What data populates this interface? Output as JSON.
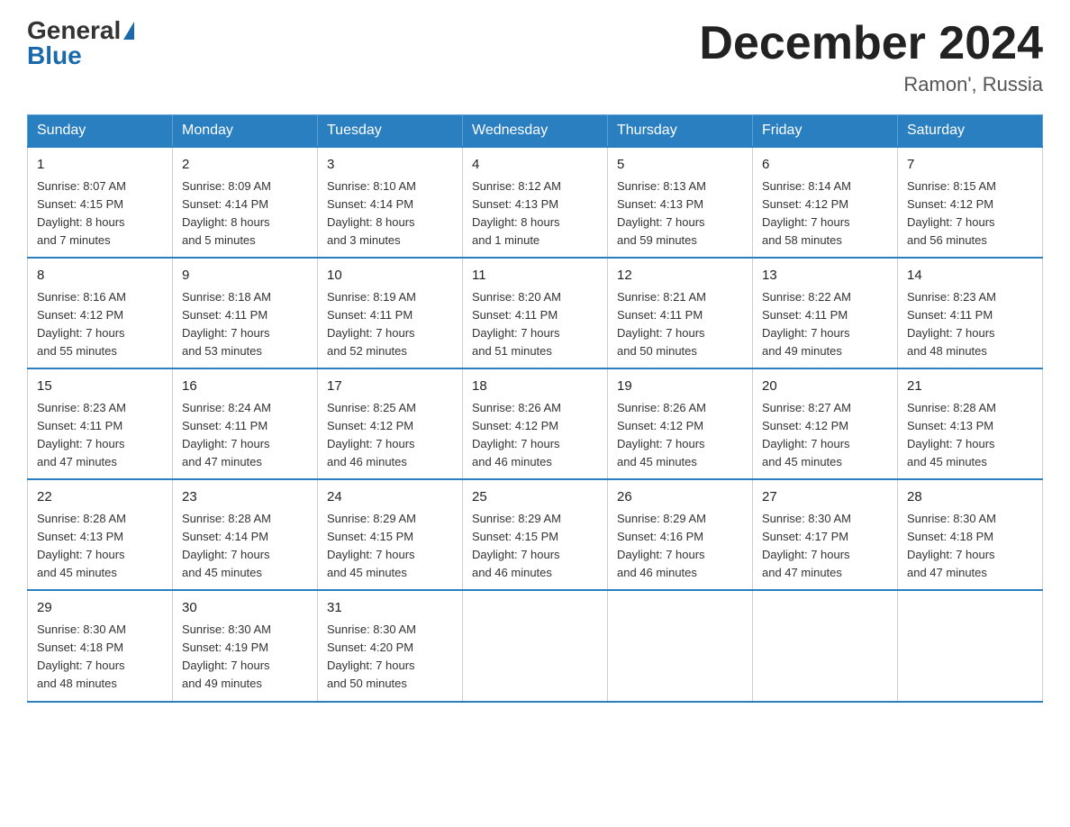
{
  "logo": {
    "general": "General",
    "blue": "Blue"
  },
  "title": {
    "month": "December 2024",
    "location": "Ramon', Russia"
  },
  "weekdays": [
    "Sunday",
    "Monday",
    "Tuesday",
    "Wednesday",
    "Thursday",
    "Friday",
    "Saturday"
  ],
  "weeks": [
    [
      {
        "day": "1",
        "sunrise": "8:07 AM",
        "sunset": "4:15 PM",
        "daylight": "8 hours and 7 minutes"
      },
      {
        "day": "2",
        "sunrise": "8:09 AM",
        "sunset": "4:14 PM",
        "daylight": "8 hours and 5 minutes"
      },
      {
        "day": "3",
        "sunrise": "8:10 AM",
        "sunset": "4:14 PM",
        "daylight": "8 hours and 3 minutes"
      },
      {
        "day": "4",
        "sunrise": "8:12 AM",
        "sunset": "4:13 PM",
        "daylight": "8 hours and 1 minute"
      },
      {
        "day": "5",
        "sunrise": "8:13 AM",
        "sunset": "4:13 PM",
        "daylight": "7 hours and 59 minutes"
      },
      {
        "day": "6",
        "sunrise": "8:14 AM",
        "sunset": "4:12 PM",
        "daylight": "7 hours and 58 minutes"
      },
      {
        "day": "7",
        "sunrise": "8:15 AM",
        "sunset": "4:12 PM",
        "daylight": "7 hours and 56 minutes"
      }
    ],
    [
      {
        "day": "8",
        "sunrise": "8:16 AM",
        "sunset": "4:12 PM",
        "daylight": "7 hours and 55 minutes"
      },
      {
        "day": "9",
        "sunrise": "8:18 AM",
        "sunset": "4:11 PM",
        "daylight": "7 hours and 53 minutes"
      },
      {
        "day": "10",
        "sunrise": "8:19 AM",
        "sunset": "4:11 PM",
        "daylight": "7 hours and 52 minutes"
      },
      {
        "day": "11",
        "sunrise": "8:20 AM",
        "sunset": "4:11 PM",
        "daylight": "7 hours and 51 minutes"
      },
      {
        "day": "12",
        "sunrise": "8:21 AM",
        "sunset": "4:11 PM",
        "daylight": "7 hours and 50 minutes"
      },
      {
        "day": "13",
        "sunrise": "8:22 AM",
        "sunset": "4:11 PM",
        "daylight": "7 hours and 49 minutes"
      },
      {
        "day": "14",
        "sunrise": "8:23 AM",
        "sunset": "4:11 PM",
        "daylight": "7 hours and 48 minutes"
      }
    ],
    [
      {
        "day": "15",
        "sunrise": "8:23 AM",
        "sunset": "4:11 PM",
        "daylight": "7 hours and 47 minutes"
      },
      {
        "day": "16",
        "sunrise": "8:24 AM",
        "sunset": "4:11 PM",
        "daylight": "7 hours and 47 minutes"
      },
      {
        "day": "17",
        "sunrise": "8:25 AM",
        "sunset": "4:12 PM",
        "daylight": "7 hours and 46 minutes"
      },
      {
        "day": "18",
        "sunrise": "8:26 AM",
        "sunset": "4:12 PM",
        "daylight": "7 hours and 46 minutes"
      },
      {
        "day": "19",
        "sunrise": "8:26 AM",
        "sunset": "4:12 PM",
        "daylight": "7 hours and 45 minutes"
      },
      {
        "day": "20",
        "sunrise": "8:27 AM",
        "sunset": "4:12 PM",
        "daylight": "7 hours and 45 minutes"
      },
      {
        "day": "21",
        "sunrise": "8:28 AM",
        "sunset": "4:13 PM",
        "daylight": "7 hours and 45 minutes"
      }
    ],
    [
      {
        "day": "22",
        "sunrise": "8:28 AM",
        "sunset": "4:13 PM",
        "daylight": "7 hours and 45 minutes"
      },
      {
        "day": "23",
        "sunrise": "8:28 AM",
        "sunset": "4:14 PM",
        "daylight": "7 hours and 45 minutes"
      },
      {
        "day": "24",
        "sunrise": "8:29 AM",
        "sunset": "4:15 PM",
        "daylight": "7 hours and 45 minutes"
      },
      {
        "day": "25",
        "sunrise": "8:29 AM",
        "sunset": "4:15 PM",
        "daylight": "7 hours and 46 minutes"
      },
      {
        "day": "26",
        "sunrise": "8:29 AM",
        "sunset": "4:16 PM",
        "daylight": "7 hours and 46 minutes"
      },
      {
        "day": "27",
        "sunrise": "8:30 AM",
        "sunset": "4:17 PM",
        "daylight": "7 hours and 47 minutes"
      },
      {
        "day": "28",
        "sunrise": "8:30 AM",
        "sunset": "4:18 PM",
        "daylight": "7 hours and 47 minutes"
      }
    ],
    [
      {
        "day": "29",
        "sunrise": "8:30 AM",
        "sunset": "4:18 PM",
        "daylight": "7 hours and 48 minutes"
      },
      {
        "day": "30",
        "sunrise": "8:30 AM",
        "sunset": "4:19 PM",
        "daylight": "7 hours and 49 minutes"
      },
      {
        "day": "31",
        "sunrise": "8:30 AM",
        "sunset": "4:20 PM",
        "daylight": "7 hours and 50 minutes"
      },
      null,
      null,
      null,
      null
    ]
  ],
  "labels": {
    "sunrise": "Sunrise:",
    "sunset": "Sunset:",
    "daylight": "Daylight:"
  }
}
